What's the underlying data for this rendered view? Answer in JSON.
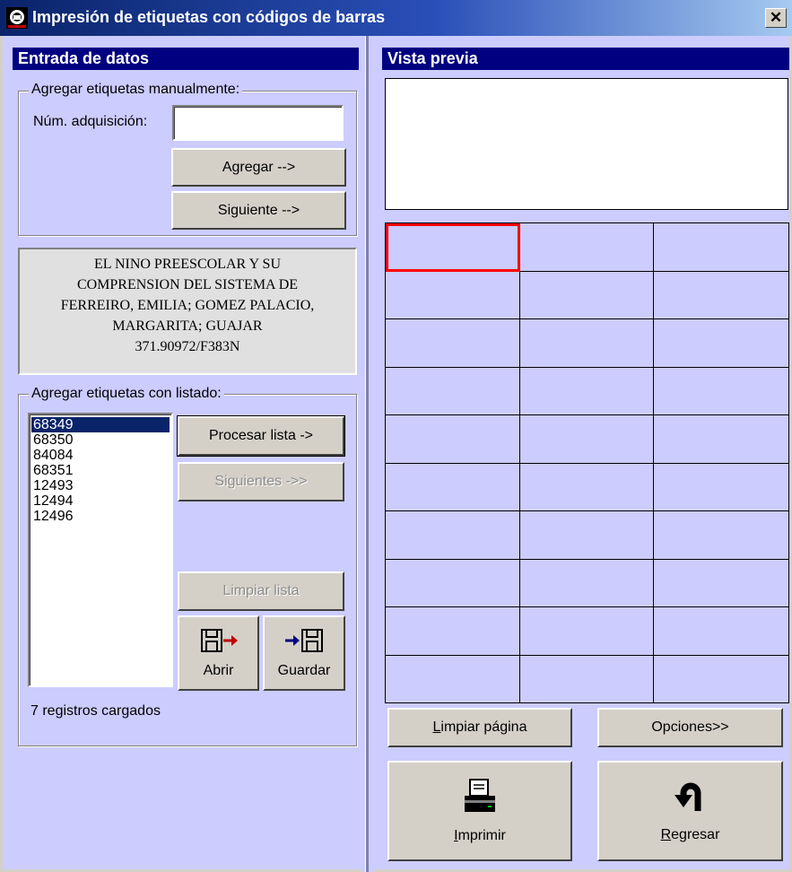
{
  "window": {
    "title": "Impresión de etiquetas con códigos de barras",
    "close_glyph": "✕"
  },
  "left": {
    "header": "Entrada de datos",
    "manual": {
      "legend": "Agregar etiquetas manualmente:",
      "acq_label": "Núm. adquisición:",
      "acq_value": "",
      "add_button": "Agregar -->",
      "next_button": "Siguiente -->"
    },
    "record": {
      "lines": [
        "EL NINO PREESCOLAR Y SU",
        "COMPRENSION DEL SISTEMA DE",
        "FERREIRO, EMILIA; GOMEZ PALACIO,",
        "MARGARITA; GUAJAR",
        "371.90972/F383N"
      ]
    },
    "listing": {
      "legend": "Agregar etiquetas con listado:",
      "items": [
        "68349",
        "68350",
        "84084",
        "68351",
        "12493",
        "12494",
        "12496"
      ],
      "selected_index": 0,
      "process_button": "Procesar lista ->",
      "next_button": "Siguientes ->>",
      "clear_button": "Limpiar lista",
      "open_button": "Abrir",
      "open_icon": "floppy-open-icon",
      "save_button": "Guardar",
      "save_icon": "floppy-save-icon",
      "status": "7 registros cargados"
    }
  },
  "right": {
    "header": "Vista previa",
    "grid": {
      "rows": 10,
      "cols": 3,
      "active_cell": [
        0,
        0
      ]
    },
    "clear_page_button": "Limpiar página",
    "options_button": "Opciones>>",
    "print_button": "Imprimir",
    "print_icon": "printer-icon",
    "back_button": "Regresar",
    "back_icon": "return-arrow-icon"
  },
  "colors": {
    "background": "#ccccff",
    "header": "#000080",
    "selection": "#0a246a",
    "active_cell": "#ff0000"
  }
}
